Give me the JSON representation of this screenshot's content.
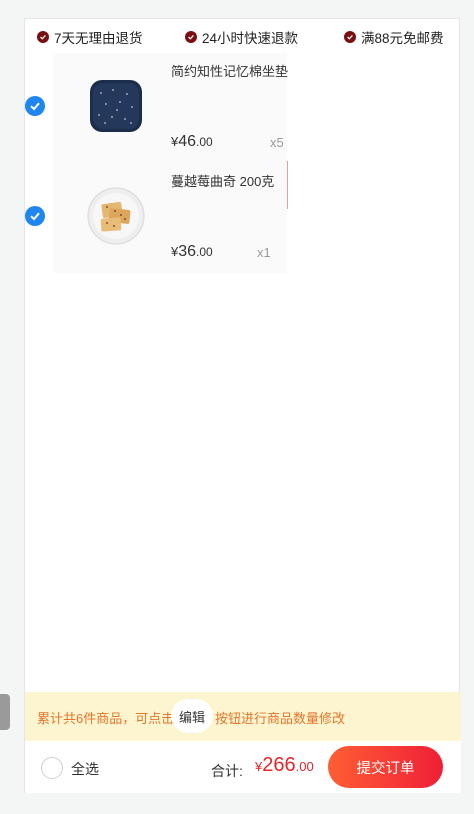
{
  "guarantees": [
    {
      "label": "7天无理由退货"
    },
    {
      "label": "24小时快速退款"
    },
    {
      "label": "满88元免邮费"
    }
  ],
  "items": [
    {
      "name": "简约知性记忆棉坐垫",
      "currency": "¥",
      "price_int": "46",
      "price_dec": ".00",
      "qty": "x5",
      "checked": true
    },
    {
      "name": "蔓越莓曲奇 200克",
      "currency": "¥",
      "price_int": "36",
      "price_dec": ".00",
      "qty": "x1",
      "checked": true
    }
  ],
  "notice": {
    "text_before": "累计共6件商品，可点击",
    "edit_label": "编辑",
    "text_after": "按钮进行商品数量修改"
  },
  "footer": {
    "select_all_label": "全选",
    "total_label": "合计:",
    "total_currency": "¥",
    "total_int": "266",
    "total_dec": ".00",
    "submit_label": "提交订单"
  },
  "colors": {
    "accent_blue": "#1f86f0",
    "price_red": "#e4262b",
    "notice_bg": "#fdf4d0",
    "notice_text": "#e2772c",
    "badge_red": "#7a0f13"
  }
}
